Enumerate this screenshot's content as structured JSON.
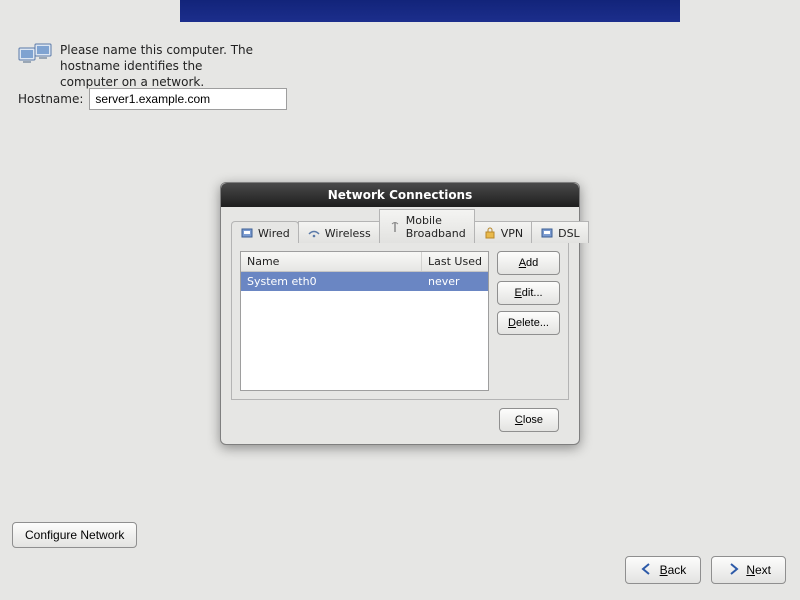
{
  "header": {
    "instruction": "Please name this computer.  The hostname identifies the computer on a network."
  },
  "hostname": {
    "label": "Hostname:",
    "value": "server1.example.com"
  },
  "dialog": {
    "title": "Network Connections",
    "tabs": [
      {
        "label": "Wired",
        "active": true
      },
      {
        "label": "Wireless",
        "active": false
      },
      {
        "label": "Mobile Broadband",
        "active": false
      },
      {
        "label": "VPN",
        "active": false
      },
      {
        "label": "DSL",
        "active": false
      }
    ],
    "list": {
      "columns": {
        "name": "Name",
        "last_used": "Last Used"
      },
      "rows": [
        {
          "name": "System eth0",
          "last_used": "never",
          "selected": true
        }
      ]
    },
    "buttons": {
      "add": "Add",
      "edit": "Edit...",
      "delete": "Delete...",
      "close": "Close"
    }
  },
  "bottom": {
    "configure": "Configure Network",
    "back": "Back",
    "next": "Next"
  }
}
